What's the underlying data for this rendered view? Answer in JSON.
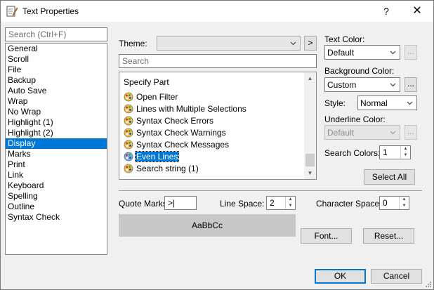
{
  "window": {
    "title": "Text Properties",
    "help_label": "?",
    "close_label": "✕",
    "icon": "notepad-pen-icon"
  },
  "search": {
    "placeholder": "Search (Ctrl+F)"
  },
  "categories": {
    "selected_index": 9,
    "items": [
      "General",
      "Scroll",
      "File",
      "Backup",
      "Auto Save",
      "Wrap",
      "No Wrap",
      "Highlight (1)",
      "Highlight (2)",
      "Display",
      "Marks",
      "Print",
      "Link",
      "Keyboard",
      "Spelling",
      "Outline",
      "Syntax Check"
    ]
  },
  "theme": {
    "label": "Theme:",
    "value": "",
    "next_label": ">"
  },
  "part_search": {
    "placeholder": "Search"
  },
  "parts": {
    "header": "Specify Part",
    "selected_index": 5,
    "items": [
      "Open Filter",
      "Lines with Multiple Selections",
      "Syntax Check Errors",
      "Syntax Check Warnings",
      "Syntax Check Messages",
      "Even Lines",
      "Search string (1)"
    ]
  },
  "text_color": {
    "label": "Text Color:",
    "value": "Default",
    "browse_label": "..."
  },
  "background_color": {
    "label": "Background Color:",
    "value": "Custom",
    "browse_label": "..."
  },
  "style": {
    "label": "Style:",
    "value": "Normal"
  },
  "underline_color": {
    "label": "Underline Color:",
    "value": "Default",
    "browse_label": "..."
  },
  "search_colors": {
    "label": "Search Colors:",
    "value": "1"
  },
  "select_all_label": "Select All",
  "quote_marks": {
    "label": "Quote Marks:",
    "value": ">|"
  },
  "line_space": {
    "label": "Line Space:",
    "value": "2"
  },
  "character_space": {
    "label": "Character Space:",
    "value": "0"
  },
  "preview": {
    "text": "AaBbCc"
  },
  "font_button_label": "Font...",
  "reset_button_label": "Reset...",
  "ok_label": "OK",
  "cancel_label": "Cancel",
  "colors": {
    "selection": "#0078d7",
    "preview_bg": "#c8c8c8",
    "window_bg": "#f0f0f0"
  }
}
